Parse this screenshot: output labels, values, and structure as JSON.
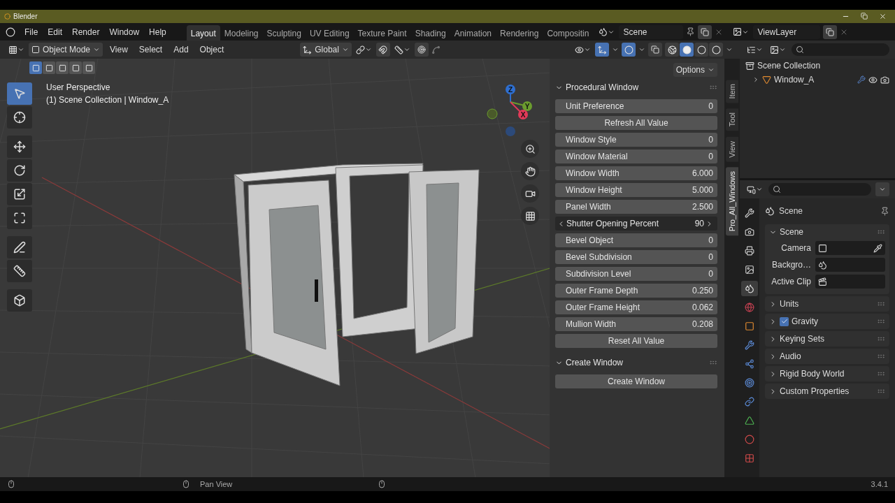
{
  "title_bar": {
    "title": "Blender"
  },
  "menu": [
    "File",
    "Edit",
    "Render",
    "Window",
    "Help"
  ],
  "workspaces": [
    {
      "label": "Layout",
      "selected": true
    },
    {
      "label": "Modeling",
      "selected": false
    },
    {
      "label": "Sculpting",
      "selected": false
    },
    {
      "label": "UV Editing",
      "selected": false
    },
    {
      "label": "Texture Paint",
      "selected": false
    },
    {
      "label": "Shading",
      "selected": false
    },
    {
      "label": "Animation",
      "selected": false
    },
    {
      "label": "Rendering",
      "selected": false
    },
    {
      "label": "Compositin",
      "selected": false
    }
  ],
  "scene": {
    "value": "Scene"
  },
  "view_layer": {
    "value": "ViewLayer"
  },
  "viewport_header": {
    "mode": "Object Mode",
    "menus": [
      "View",
      "Select",
      "Add",
      "Object"
    ],
    "orientation": "Global",
    "options": "Options",
    "shading": [
      {
        "kind": "wireframe",
        "selected": false
      },
      {
        "kind": "solid",
        "selected": true
      },
      {
        "kind": "material",
        "selected": false
      },
      {
        "kind": "rendered",
        "selected": false
      }
    ]
  },
  "select_modes": [
    {
      "selected": true
    },
    {
      "selected": false
    },
    {
      "selected": false
    },
    {
      "selected": false
    },
    {
      "selected": false
    }
  ],
  "tools": [
    {
      "kind": "select",
      "selected": true
    },
    {
      "kind": "cursor",
      "selected": false
    },
    {
      "kind": "move",
      "selected": false
    },
    {
      "kind": "rotate",
      "selected": false
    },
    {
      "kind": "scale",
      "selected": false
    },
    {
      "kind": "transform",
      "selected": false
    },
    {
      "kind": "annotate",
      "selected": false
    },
    {
      "kind": "measure",
      "selected": false
    },
    {
      "kind": "add-cube",
      "selected": false
    }
  ],
  "overlay_text": [
    "User Perspective",
    "(1) Scene Collection | Window_A"
  ],
  "gizmo": {
    "axes": [
      {
        "label": "Z",
        "color": "#2e6fd1"
      },
      {
        "label": "Y",
        "color": "#6b9c2e"
      },
      {
        "label": "X",
        "color": "#e23a58"
      }
    ]
  },
  "sidebar_tabs": [
    {
      "label": "Item",
      "selected": false
    },
    {
      "label": "Tool",
      "selected": false
    },
    {
      "label": "View",
      "selected": false
    },
    {
      "label": "Pro_All_Windows",
      "selected": true
    }
  ],
  "panels": [
    {
      "title": "Procedural Window",
      "expanded": true,
      "rows": [
        {
          "kind": "field",
          "label": "Unit Preference",
          "value": "0",
          "hovered": false
        },
        {
          "kind": "button",
          "label": "Refresh All Value"
        },
        {
          "kind": "field",
          "label": "Window Style",
          "value": "0",
          "hovered": false
        },
        {
          "kind": "field",
          "label": "Window Material",
          "value": "0",
          "hovered": false
        },
        {
          "kind": "field",
          "label": "Window Width",
          "value": "6.000",
          "hovered": false
        },
        {
          "kind": "field",
          "label": "Window Height",
          "value": "5.000",
          "hovered": false
        },
        {
          "kind": "field",
          "label": "Panel Width",
          "value": "2.500",
          "hovered": false
        },
        {
          "kind": "field",
          "label": "Shutter Opening Percent",
          "value": "90",
          "hovered": true
        },
        {
          "kind": "field",
          "label": "Bevel Object",
          "value": "0",
          "hovered": false
        },
        {
          "kind": "field",
          "label": "Bevel Subdivision",
          "value": "0",
          "hovered": false
        },
        {
          "kind": "field",
          "label": "Subdivision Level",
          "value": "0",
          "hovered": false
        },
        {
          "kind": "field",
          "label": "Outer Frame Depth",
          "value": "0.250",
          "hovered": false
        },
        {
          "kind": "field",
          "label": "Outer Frame Height",
          "value": "0.062",
          "hovered": false
        },
        {
          "kind": "field",
          "label": "Mullion Width",
          "value": "0.208",
          "hovered": false
        },
        {
          "kind": "button",
          "label": "Reset All Value"
        }
      ]
    },
    {
      "title": "Create Window",
      "expanded": true,
      "rows": [
        {
          "kind": "button",
          "label": "Create Window"
        }
      ]
    }
  ],
  "outliner": {
    "items": [
      {
        "label": "Scene Collection",
        "children": [
          {
            "label": "Window_A",
            "expanded": false
          }
        ]
      }
    ]
  },
  "properties": {
    "context": "Scene",
    "tabs": [
      {
        "kind": "tool",
        "selected": false
      },
      {
        "kind": "render",
        "selected": false
      },
      {
        "kind": "output",
        "selected": false
      },
      {
        "kind": "view-layer",
        "selected": false
      },
      {
        "kind": "scene",
        "selected": true
      },
      {
        "kind": "world",
        "selected": false
      },
      {
        "kind": "object",
        "selected": false
      },
      {
        "kind": "modifier",
        "selected": false
      },
      {
        "kind": "particles",
        "selected": false
      },
      {
        "kind": "physics",
        "selected": false
      },
      {
        "kind": "constraint",
        "selected": false
      },
      {
        "kind": "data",
        "selected": false
      },
      {
        "kind": "material",
        "selected": false
      },
      {
        "kind": "texture",
        "selected": false
      }
    ],
    "panels": [
      {
        "kind": "plain",
        "title": "Scene",
        "expanded": true,
        "fields": [
          {
            "kind": "camera",
            "label": "Camera"
          },
          {
            "kind": "scene",
            "label": "Backgro…"
          },
          {
            "kind": "clip",
            "label": "Active Clip"
          }
        ]
      },
      {
        "kind": "plain",
        "title": "Units",
        "expanded": false
      },
      {
        "kind": "toggle",
        "title": "Gravity",
        "expanded": false,
        "checked": true
      },
      {
        "kind": "plain",
        "title": "Keying Sets",
        "expanded": false
      },
      {
        "kind": "plain",
        "title": "Audio",
        "expanded": false
      },
      {
        "kind": "plain",
        "title": "Rigid Body World",
        "expanded": false
      },
      {
        "kind": "plain",
        "title": "Custom Properties",
        "expanded": false
      }
    ]
  },
  "status_bar": {
    "hint": "Pan View",
    "version": "3.4.1"
  }
}
